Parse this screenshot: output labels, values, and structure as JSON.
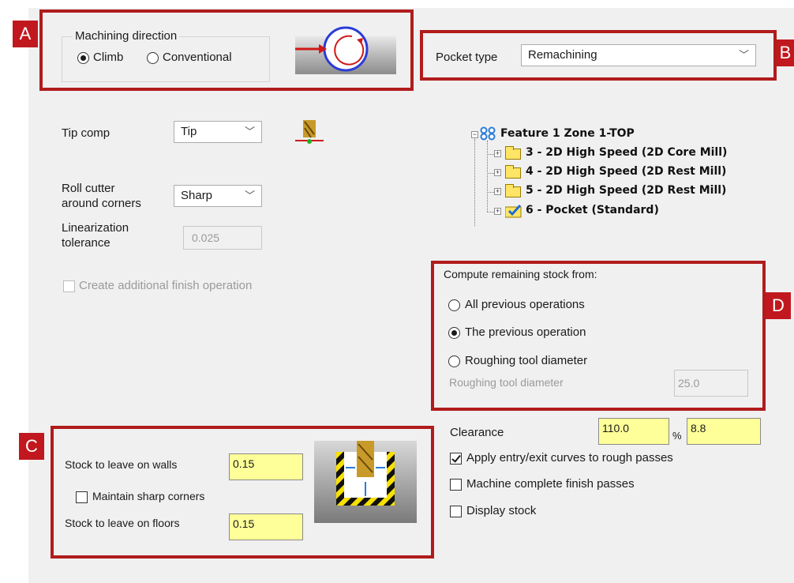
{
  "callouts": {
    "a": "A",
    "b": "B",
    "c": "C",
    "d": "D"
  },
  "machining_direction": {
    "group_label": "Machining direction",
    "options": [
      "Climb",
      "Conventional"
    ],
    "selected": "Climb"
  },
  "pocket_type": {
    "label": "Pocket type",
    "value": "Remachining"
  },
  "tip_comp": {
    "label": "Tip comp",
    "value": "Tip"
  },
  "roll_cutter": {
    "label_line1": "Roll cutter",
    "label_line2": "around corners",
    "value": "Sharp"
  },
  "linearization": {
    "label_line1": "Linearization",
    "label_line2": "tolerance",
    "value": "0.025"
  },
  "finish_op": {
    "label": "Create additional finish operation",
    "checked": false
  },
  "tree": {
    "root": "Feature 1 Zone 1-TOP",
    "items": [
      "3 - 2D High Speed (2D Core Mill)",
      "4 - 2D High Speed (2D Rest Mill)",
      "5 - 2D High Speed (2D Rest Mill)",
      "6 - Pocket (Standard)"
    ]
  },
  "remaining_stock": {
    "group_label": "Compute remaining stock from:",
    "options": [
      "All previous operations",
      "The previous operation",
      "Roughing tool diameter"
    ],
    "selected": "The previous operation",
    "diameter_label": "Roughing tool diameter",
    "diameter_value": "25.0"
  },
  "stock": {
    "walls_label": "Stock to leave on walls",
    "walls_value": "0.15",
    "sharp_corners_label": "Maintain sharp corners",
    "floors_label": "Stock to leave on floors",
    "floors_value": "0.15"
  },
  "clearance": {
    "label": "Clearance",
    "percent_value": "110.0",
    "percent_sign": "%",
    "absolute_value": "8.8"
  },
  "options": {
    "entry_exit": {
      "label": "Apply entry/exit curves to rough passes",
      "checked": true
    },
    "finish_passes": {
      "label": "Machine complete finish passes",
      "checked": false
    },
    "display_stock": {
      "label": "Display stock",
      "checked": false
    }
  },
  "colors": {
    "callout_red": "#c0181e",
    "yellow_field": "#ffff99",
    "panel": "#f0f0f0"
  }
}
